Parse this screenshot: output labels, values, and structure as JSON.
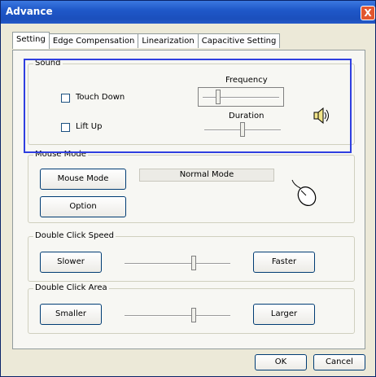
{
  "window": {
    "title": "Advance",
    "close_label": "X"
  },
  "tabs": [
    "Setting",
    "Edge Compensation",
    "Linearization",
    "Capacitive Setting"
  ],
  "sound": {
    "label": "Sound",
    "touch_down": "Touch Down",
    "lift_up": "Lift Up",
    "frequency_label": "Frequency",
    "duration_label": "Duration",
    "frequency_level": 0.2,
    "duration_level": 0.5
  },
  "mouse_mode": {
    "label": "Mouse Mode",
    "mouse_mode_button": "Mouse Mode",
    "option_button": "Option",
    "current_mode": "Normal Mode"
  },
  "double_click_speed": {
    "label": "Double Click Speed",
    "slower": "Slower",
    "faster": "Faster",
    "level": 0.65
  },
  "double_click_area": {
    "label": "Double Click Area",
    "smaller": "Smaller",
    "larger": "Larger",
    "level": 0.65
  },
  "footer": {
    "ok": "OK",
    "cancel": "Cancel"
  },
  "icons": {
    "speaker": "speaker-icon",
    "mouse": "mouse-icon"
  }
}
